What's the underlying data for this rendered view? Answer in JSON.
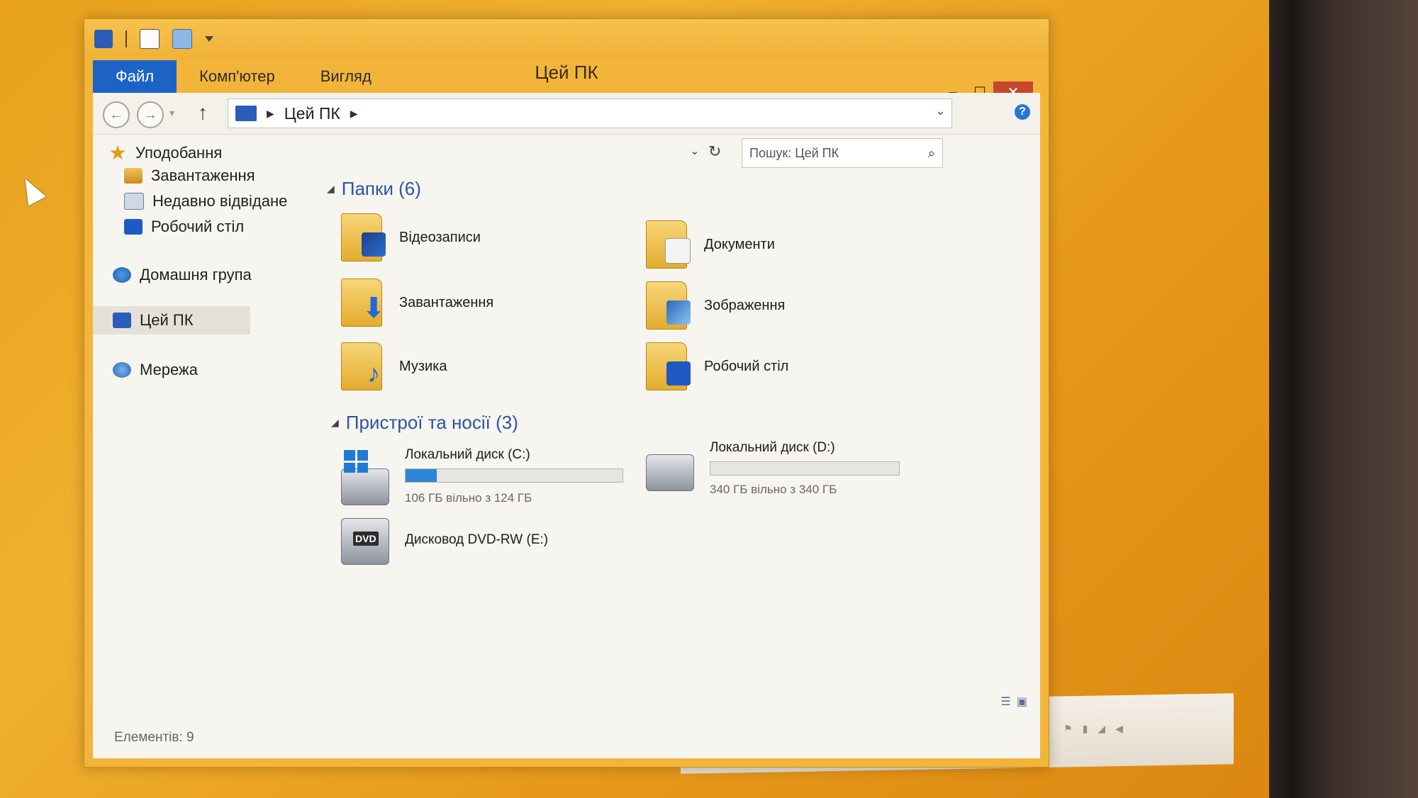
{
  "window": {
    "title": "Цей ПК"
  },
  "ribbon": {
    "tabs": [
      "Файл",
      "Комп'ютер",
      "Вигляд"
    ]
  },
  "address": {
    "path": "Цей ПК"
  },
  "search": {
    "placeholder": "Пошук: Цей ПК"
  },
  "sidebar": {
    "favorites": "Уподобання",
    "fav_items": [
      "Завантаження",
      "Недавно відвідане",
      "Робочий стіл"
    ],
    "homegroup": "Домашня група",
    "this_pc": "Цей ПК",
    "network": "Мережа"
  },
  "folders": {
    "header": "Папки (6)",
    "items": [
      "Відеозаписи",
      "Документи",
      "Завантаження",
      "Зображення",
      "Музика",
      "Робочий стіл"
    ]
  },
  "devices": {
    "header": "Пристрої та носії (3)",
    "drives": [
      {
        "name": "Локальний диск (C:)",
        "free": "106 ГБ вільно з 124 ГБ",
        "used_fraction": 0.145
      },
      {
        "name": "Локальний диск (D:)",
        "free": "340 ГБ вільно з 340 ГБ",
        "used_fraction": 0.0
      },
      {
        "name": "Дисковод DVD-RW (E:)"
      }
    ]
  },
  "status": {
    "count": "Елементів: 9"
  },
  "colors": {
    "accent": "#1d63c6",
    "desktop": "#f0b030",
    "close": "#c7472e",
    "bar_fill": "#2e86d8"
  }
}
